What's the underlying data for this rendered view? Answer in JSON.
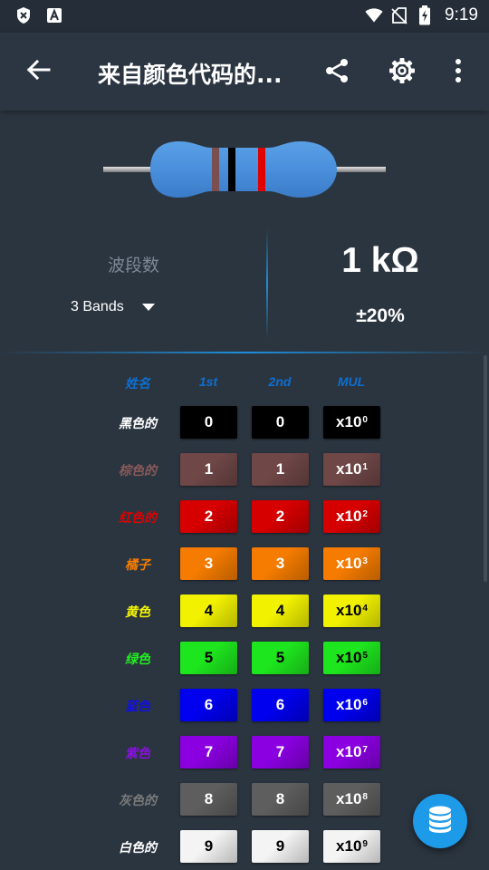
{
  "status_bar": {
    "time": "9:19"
  },
  "app_bar": {
    "title": "来自颜色代码的..."
  },
  "bands": {
    "label": "波段数",
    "selected": "3 Bands"
  },
  "result": {
    "value": "1 kΩ",
    "tolerance": "±20%"
  },
  "resistor_bands": [
    "#7b4f4f",
    "#000000",
    "#e00000"
  ],
  "table": {
    "headers": {
      "name": "姓名",
      "first": "1st",
      "second": "2nd",
      "mul": "MUL"
    },
    "rows": [
      {
        "name": "黑色的",
        "d1": "0",
        "d2": "0",
        "mul_base": "x10",
        "mul_exp": "0",
        "color": "#000000",
        "name_color": "#ffffff",
        "text_color": "#ffffff"
      },
      {
        "name": "棕色的",
        "d1": "1",
        "d2": "1",
        "mul_base": "x10",
        "mul_exp": "1",
        "color": "#6f4747",
        "name_color": "#8a5a5a",
        "text_color": "#ffffff"
      },
      {
        "name": "红色的",
        "d1": "2",
        "d2": "2",
        "mul_base": "x10",
        "mul_exp": "2",
        "color": "#d60000",
        "name_color": "#e00000",
        "text_color": "#ffffff"
      },
      {
        "name": "橘子",
        "d1": "3",
        "d2": "3",
        "mul_base": "x10",
        "mul_exp": "3",
        "color": "#f57c00",
        "name_color": "#f57c00",
        "text_color": "#ffffff"
      },
      {
        "name": "黄色",
        "d1": "4",
        "d2": "4",
        "mul_base": "x10",
        "mul_exp": "4",
        "color": "#f2f200",
        "name_color": "#f5f500",
        "text_color": "#000000"
      },
      {
        "name": "绿色",
        "d1": "5",
        "d2": "5",
        "mul_base": "x10",
        "mul_exp": "5",
        "color": "#1ee61e",
        "name_color": "#22ee22",
        "text_color": "#000000"
      },
      {
        "name": "蓝色",
        "d1": "6",
        "d2": "6",
        "mul_base": "x10",
        "mul_exp": "6",
        "color": "#0000ee",
        "name_color": "#1010e0",
        "text_color": "#ffffff"
      },
      {
        "name": "紫色",
        "d1": "7",
        "d2": "7",
        "mul_base": "x10",
        "mul_exp": "7",
        "color": "#8a00e0",
        "name_color": "#8a10e0",
        "text_color": "#ffffff"
      },
      {
        "name": "灰色的",
        "d1": "8",
        "d2": "8",
        "mul_base": "x10",
        "mul_exp": "8",
        "color": "#5e5e5e",
        "name_color": "#7a7a7a",
        "text_color": "#ffffff"
      },
      {
        "name": "白色的",
        "d1": "9",
        "d2": "9",
        "mul_base": "x10",
        "mul_exp": "9",
        "color": "#f4f4f4",
        "name_color": "#ffffff",
        "text_color": "#000000"
      }
    ]
  },
  "icons": {
    "status": [
      "shield-icon",
      "text-a-icon",
      "wifi-icon",
      "no-sim-icon",
      "battery-charging-icon"
    ],
    "app_bar": [
      "back-arrow-icon",
      "share-icon",
      "gear-icon",
      "more-vert-icon"
    ],
    "fab": "database-icon"
  },
  "colors": {
    "accent": "#1e9be8",
    "header_blue": "#0d6fd1",
    "background": "#2b3540"
  }
}
